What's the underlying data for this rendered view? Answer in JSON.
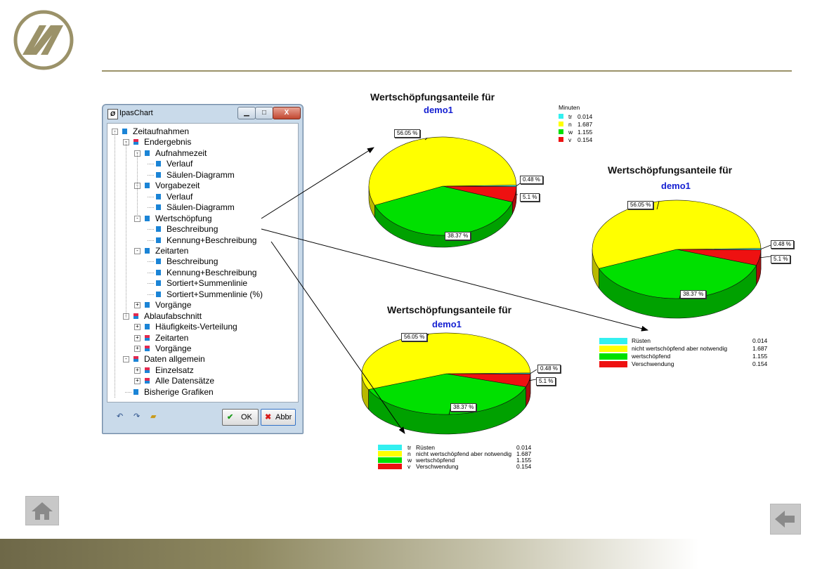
{
  "colors": {
    "ruesten": "#33f0f0",
    "nicht_wert": "#ffff00",
    "wert": "#00e000",
    "verschwendung": "#ee1111",
    "title_blue": "#1520d2",
    "accent_olive": "#9b9269"
  },
  "window": {
    "title": "IpasChart",
    "min_label": "▁",
    "max_label": "□",
    "close_label": "X",
    "ok_label": "OK",
    "abbr_label": "Abbr",
    "toolbar_icons": [
      "undo-icon",
      "redo-icon",
      "open-folder-icon"
    ]
  },
  "tree": [
    {
      "label": "Zeitaufnahmen",
      "level": 0,
      "exp": "-",
      "icon": "blue"
    },
    {
      "label": "Endergebnis",
      "level": 1,
      "exp": "-",
      "icon": "red"
    },
    {
      "label": "Aufnahmezeit",
      "level": 2,
      "exp": "-",
      "icon": "blue"
    },
    {
      "label": "Verlauf",
      "level": 3,
      "exp": "",
      "icon": "blue"
    },
    {
      "label": "Säulen-Diagramm",
      "level": 3,
      "exp": "",
      "icon": "blue"
    },
    {
      "label": "Vorgabezeit",
      "level": 2,
      "exp": "-",
      "icon": "blue"
    },
    {
      "label": "Verlauf",
      "level": 3,
      "exp": "",
      "icon": "blue"
    },
    {
      "label": "Säulen-Diagramm",
      "level": 3,
      "exp": "",
      "icon": "blue"
    },
    {
      "label": "Wertschöpfung",
      "level": 2,
      "exp": "-",
      "icon": "blue"
    },
    {
      "label": "Beschreibung",
      "level": 3,
      "exp": "",
      "icon": "blue"
    },
    {
      "label": "Kennung+Beschreibung",
      "level": 3,
      "exp": "",
      "icon": "blue"
    },
    {
      "label": "Zeitarten",
      "level": 2,
      "exp": "-",
      "icon": "blue"
    },
    {
      "label": "Beschreibung",
      "level": 3,
      "exp": "",
      "icon": "blue"
    },
    {
      "label": "Kennung+Beschreibung",
      "level": 3,
      "exp": "",
      "icon": "blue"
    },
    {
      "label": "Sortiert+Summenlinie",
      "level": 3,
      "exp": "",
      "icon": "blue"
    },
    {
      "label": "Sortiert+Summenlinie (%)",
      "level": 3,
      "exp": "",
      "icon": "blue"
    },
    {
      "label": "Vorgänge",
      "level": 2,
      "exp": "+",
      "icon": "blue"
    },
    {
      "label": "Ablaufabschnitt",
      "level": 1,
      "exp": "-",
      "icon": "red"
    },
    {
      "label": "Häufigkeits-Verteilung",
      "level": 2,
      "exp": "+",
      "icon": "blue"
    },
    {
      "label": "Zeitarten",
      "level": 2,
      "exp": "+",
      "icon": "red"
    },
    {
      "label": "Vorgänge",
      "level": 2,
      "exp": "+",
      "icon": "red"
    },
    {
      "label": "Daten allgemein",
      "level": 1,
      "exp": "-",
      "icon": "red"
    },
    {
      "label": "Einzelsatz",
      "level": 2,
      "exp": "+",
      "icon": "red"
    },
    {
      "label": "Alle Datensätze",
      "level": 2,
      "exp": "+",
      "icon": "red"
    },
    {
      "label": "Bisherige Grafiken",
      "level": 1,
      "exp": "",
      "icon": "blue"
    }
  ],
  "chart_data": [
    {
      "type": "pie",
      "title": "Wertschöpfungsanteile für",
      "subtitle": "demo1",
      "categories": [
        "tr",
        "n",
        "w",
        "v"
      ],
      "values": [
        0.014,
        1.687,
        1.155,
        0.154
      ],
      "percent_labels": [
        "0.48 %",
        "56.05 %",
        "38.37 %",
        "5.1 %"
      ],
      "legend_title": "Minuten",
      "legend_placement": "top-right",
      "legend_entries": [
        {
          "key": "tr",
          "value": "0.014"
        },
        {
          "key": "n",
          "value": "1.687"
        },
        {
          "key": "w",
          "value": "1.155"
        },
        {
          "key": "v",
          "value": "0.154"
        }
      ]
    },
    {
      "type": "pie",
      "title": "Wertschöpfungsanteile für",
      "subtitle": "demo1",
      "categories": [
        "Rüsten",
        "nicht wertschöpfend aber notwendig",
        "wertschöpfend",
        "Verschwendung"
      ],
      "values": [
        0.014,
        1.687,
        1.155,
        0.154
      ],
      "percent_labels": [
        "0.48 %",
        "56.05 %",
        "38.37 %",
        "5.1 %"
      ],
      "legend_placement": "bottom",
      "legend_entries": [
        {
          "key": "Rüsten",
          "value": "0.014"
        },
        {
          "key": "nicht wertschöpfend aber notwendig",
          "value": "1.687"
        },
        {
          "key": "wertschöpfend",
          "value": "1.155"
        },
        {
          "key": "Verschwendung",
          "value": "0.154"
        }
      ]
    },
    {
      "type": "pie",
      "title": "Wertschöpfungsanteile für",
      "subtitle": "demo1",
      "categories": [
        "Rüsten",
        "nicht wertschöpfend aber notwendig",
        "wertschöpfend",
        "Verschwendung"
      ],
      "values": [
        0.014,
        1.687,
        1.155,
        0.154
      ],
      "percent_labels": [
        "0.48 %",
        "56.05 %",
        "38.37 %",
        "5.1 %"
      ],
      "legend_placement": "bottom",
      "legend_entries": [
        {
          "key": "tr",
          "label": "Rüsten",
          "value": "0.014"
        },
        {
          "key": "n",
          "label": "nicht wertschöpfend aber notwendig",
          "value": "1.687"
        },
        {
          "key": "w",
          "label": "wertschöpfend",
          "value": "1.155"
        },
        {
          "key": "v",
          "label": "Verschwendung",
          "value": "0.154"
        }
      ]
    }
  ]
}
